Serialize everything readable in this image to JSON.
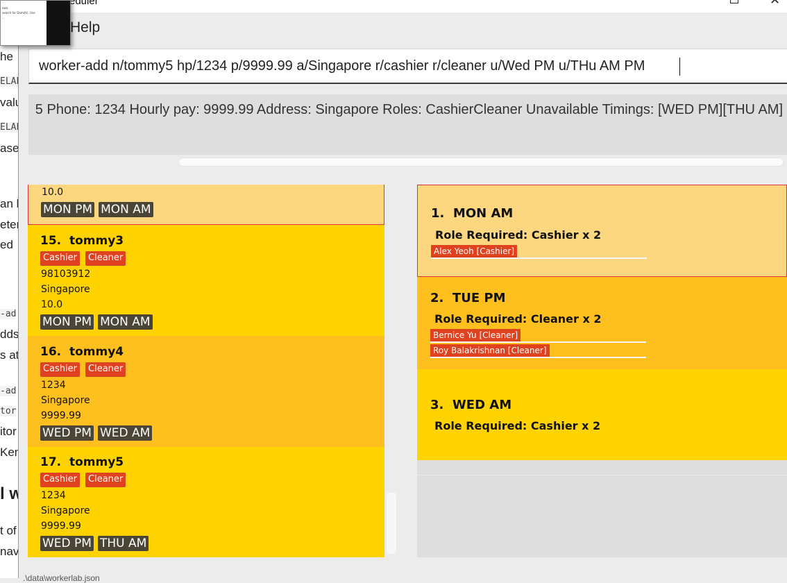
{
  "window": {
    "title": "eduler"
  },
  "menu": {
    "help_label": "Help"
  },
  "command": {
    "value": "worker-add n/tommy5 hp/1234 p/9999.99 a/Singapore r/cashier r/cleaner u/Wed PM u/THu AM PM"
  },
  "result": {
    "text": "5 Phone: 1234 Hourly pay: 9999.99 Address: Singapore Roles: CashierCleaner Unavailable Timings: [WED PM][THU AM]"
  },
  "background_doc": {
    "lines": [
      "he",
      "ELAE",
      "valu",
      "ELAE",
      "asel",
      "an b",
      "eter",
      "ed",
      "-ad",
      "dds",
      "s at",
      "-ad",
      "tor",
      "itor",
      "Ken",
      "l w",
      "t of",
      "nav"
    ],
    "thumb_lines": [
      "own,",
      "search for Damith). Use",
      "..."
    ]
  },
  "workers": [
    {
      "index": "",
      "name": "",
      "pay": "10.0",
      "roles": [],
      "timings": [
        "MON PM",
        "MON AM"
      ]
    },
    {
      "index": "15.",
      "name": "tommy3",
      "roles": [
        "Cashier",
        "Cleaner"
      ],
      "phone": "98103912",
      "address": "Singapore",
      "pay": "10.0",
      "timings": [
        "MON PM",
        "MON AM"
      ]
    },
    {
      "index": "16.",
      "name": "tommy4",
      "roles": [
        "Cashier",
        "Cleaner"
      ],
      "phone": "1234",
      "address": "Singapore",
      "pay": "9999.99",
      "timings": [
        "WED PM",
        "WED AM"
      ]
    },
    {
      "index": "17.",
      "name": "tommy5",
      "roles": [
        "Cashier",
        "Cleaner"
      ],
      "phone": "1234",
      "address": "Singapore",
      "pay": "9999.99",
      "timings": [
        "WED PM",
        "THU AM"
      ]
    }
  ],
  "shifts": [
    {
      "index": "1.",
      "name": "MON AM",
      "role_required": "Role Required: Cashier x 2",
      "assigned": [
        "Alex Yeoh [Cashier]"
      ]
    },
    {
      "index": "2.",
      "name": "TUE PM",
      "role_required": "Role Required: Cleaner x 2",
      "assigned": [
        "Bernice Yu [Cleaner]",
        "Roy Balakrishnan [Cleaner]"
      ]
    },
    {
      "index": "3.",
      "name": "WED AM",
      "role_required": "Role Required: Cashier x 2",
      "assigned": []
    }
  ],
  "status": {
    "text": ".\\data\\workerlab.json"
  },
  "colors": {
    "card_selected": "#fcd77f",
    "card_odd": "#fed300",
    "card_even": "#fec01e",
    "tag_role": "#e0421f",
    "tag_time": "#4a4536",
    "selected_border": "#e0323c"
  }
}
